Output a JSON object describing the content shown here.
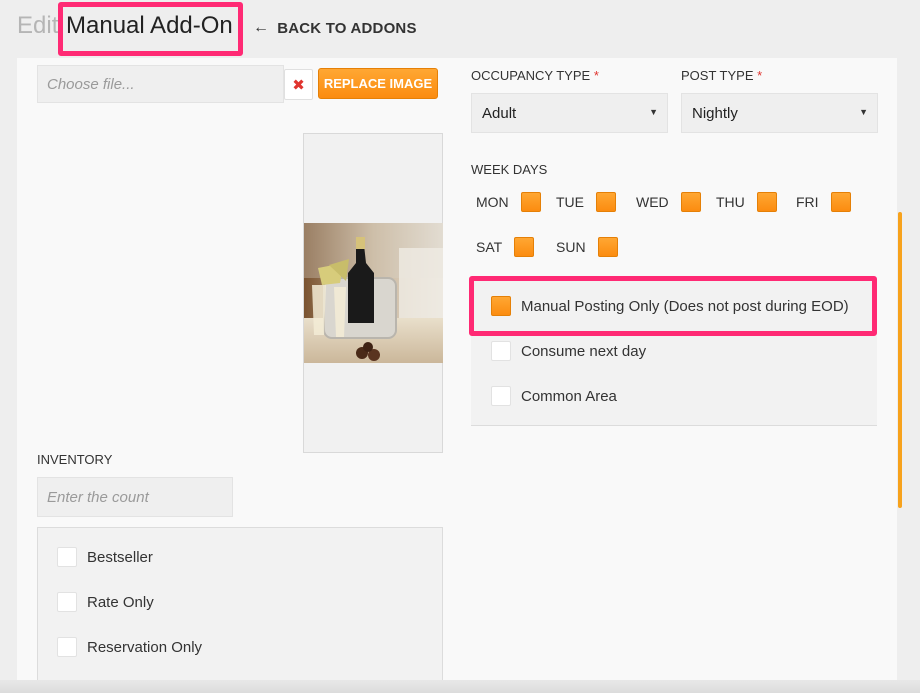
{
  "header": {
    "edit_prefix": "Edit",
    "title": "Manual Add-On",
    "back_label": "BACK TO ADDONS"
  },
  "image": {
    "file_placeholder": "Choose file...",
    "clear_icon": "close-icon",
    "replace_label": "REPLACE IMAGE"
  },
  "inventory": {
    "label": "INVENTORY",
    "placeholder": "Enter the count"
  },
  "flags": [
    {
      "label": "Bestseller",
      "checked": false
    },
    {
      "label": "Rate Only",
      "checked": false
    },
    {
      "label": "Reservation Only",
      "checked": false
    }
  ],
  "occupancy": {
    "label": "OCCUPANCY TYPE",
    "required_mark": "*",
    "value": "Adult"
  },
  "post_type": {
    "label": "POST TYPE",
    "required_mark": "*",
    "value": "Nightly"
  },
  "week_days": {
    "label": "WEEK DAYS",
    "days": [
      {
        "label": "MON",
        "checked": true
      },
      {
        "label": "TUE",
        "checked": true
      },
      {
        "label": "WED",
        "checked": true
      },
      {
        "label": "THU",
        "checked": true
      },
      {
        "label": "FRI",
        "checked": true
      },
      {
        "label": "SAT",
        "checked": true
      },
      {
        "label": "SUN",
        "checked": true
      }
    ]
  },
  "options": [
    {
      "label": "Manual Posting Only (Does not post during EOD)",
      "checked": true
    },
    {
      "label": "Consume next day",
      "checked": false
    },
    {
      "label": "Common Area",
      "checked": false
    }
  ],
  "colors": {
    "accent": "#fb8c10",
    "highlight": "#ff2a74",
    "required": "#e0342f"
  }
}
